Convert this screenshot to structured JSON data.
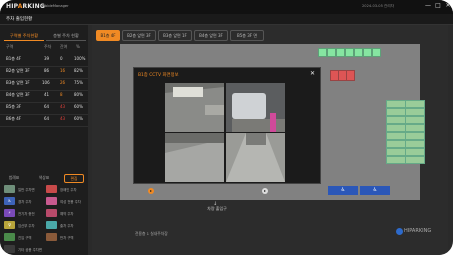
{
  "app": {
    "logo_part1": "HI",
    "logo_mid": "P",
    "logo_o": "A",
    "logo_part2": "RKING",
    "subtitle": "DubbleManager",
    "title_info": "2024-03-05  관리자",
    "min": "—",
    "max": "□",
    "close": "✕"
  },
  "subbar": {
    "label": "주차 출입현황"
  },
  "sidebar": {
    "tabs": [
      "구역별 주차현황",
      "층별 주차 현황"
    ],
    "headers": [
      "구역",
      "주차",
      "잔여",
      "%"
    ],
    "rows": [
      {
        "zone": "B1층 4F",
        "parked": "39",
        "left": "0",
        "pct": "100%"
      },
      {
        "zone": "B2층 앞면 3F",
        "parked": "86",
        "left": "16",
        "pct": "82%"
      },
      {
        "zone": "B3층 앞면 1F",
        "parked": "106",
        "left": "26",
        "pct": "75%"
      },
      {
        "zone": "B4층 앞면 3F",
        "parked": "41",
        "left": "8",
        "pct": "80%"
      },
      {
        "zone": "B5층 3F",
        "parked": "64",
        "left": "43",
        "pct": "60%"
      },
      {
        "zone": "B6층 4F",
        "parked": "64",
        "left": "43",
        "pct": "60%"
      }
    ],
    "legend_tabs": [
      "범례표",
      "색상표",
      "편집"
    ],
    "legend": [
      {
        "label": "일반 주차면",
        "color": "#6f8f7a",
        "glyph": ""
      },
      {
        "label": "장애인 주차",
        "color": "#c84a4a",
        "glyph": ""
      },
      {
        "label": "경차 주차",
        "color": "#3d63b8",
        "glyph": "♿"
      },
      {
        "label": "여성 전용 주차",
        "color": "#c85a8f",
        "glyph": ""
      },
      {
        "label": "전기차 충전",
        "color": "#7a4ab8",
        "glyph": "⚡"
      },
      {
        "label": "예약 주차",
        "color": "#b84a6a",
        "glyph": ""
      },
      {
        "label": "임산부 주차",
        "color": "#b8a43a",
        "glyph": "♀"
      },
      {
        "label": "출차 주차",
        "color": "#4aa8a8",
        "glyph": ""
      },
      {
        "label": "진입 구역",
        "color": "#4a8a4a",
        "glyph": ""
      },
      {
        "label": "만차 구역",
        "color": "#8a5a3a",
        "glyph": ""
      },
      {
        "label": "기타 공용 주차면",
        "color": "#3a3a3a",
        "glyph": ""
      }
    ]
  },
  "main": {
    "zone_tabs": [
      "B1층 4F",
      "B2층 앞면 3F",
      "B3층 앞면 1F",
      "B4층 앞면 3F",
      "B5층 3F 면"
    ],
    "exit_label": "차량 출입구",
    "exit_arrow": "↓",
    "bottom_info": "전용층 1 실내주차장",
    "brand": "HIPARKING"
  },
  "modal": {
    "title": "B1층 CCTV 화면정보",
    "close": "✕"
  }
}
